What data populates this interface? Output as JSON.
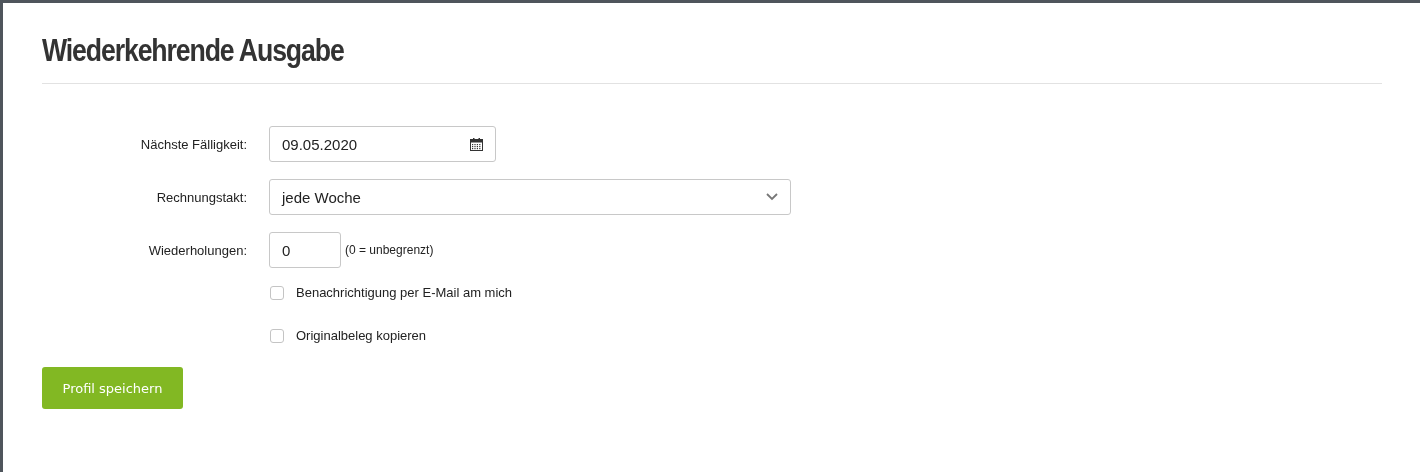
{
  "title": "Wiederkehrende Ausgabe",
  "fields": [
    {
      "kind": "date",
      "label": "Nächste Fälligkeit:",
      "value": "09.05.2020"
    },
    {
      "kind": "select",
      "label": "Rechnungstakt:",
      "value": "jede Woche"
    },
    {
      "kind": "number",
      "label": "Wiederholungen:",
      "value": "0",
      "hint": "(0 = unbegrenzt)"
    }
  ],
  "checkboxes": [
    {
      "label": "Benachrichtigung per E-Mail am mich",
      "checked": false
    },
    {
      "label": "Originalbeleg kopieren",
      "checked": false
    }
  ],
  "save_button": "Profil speichern"
}
